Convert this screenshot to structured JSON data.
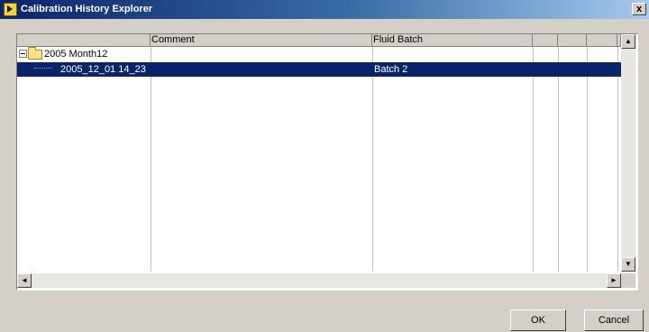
{
  "window": {
    "title": "Calibration History Explorer",
    "close_glyph": "x"
  },
  "table": {
    "columns": [
      {
        "label": ""
      },
      {
        "label": "Comment"
      },
      {
        "label": "Fluid Batch"
      },
      {
        "label": ""
      },
      {
        "label": ""
      },
      {
        "label": ""
      },
      {
        "label": ""
      }
    ],
    "rows": [
      {
        "name": "2005 Month12",
        "comment": "",
        "fluid_batch": "",
        "selected": false,
        "type": "folder",
        "expanded": true
      },
      {
        "name": "2005_12_01 14_23",
        "comment": "",
        "fluid_batch": "Batch 2",
        "selected": true,
        "type": "item"
      }
    ]
  },
  "scrollbar": {
    "up": "▲",
    "down": "▼",
    "left": "◄",
    "right": "►"
  },
  "buttons": {
    "ok": "OK",
    "cancel": "Cancel"
  },
  "colors": {
    "selection": "#0a246a",
    "title_start": "#0a246a",
    "title_end": "#a6caf0",
    "face": "#d4d0c8"
  }
}
